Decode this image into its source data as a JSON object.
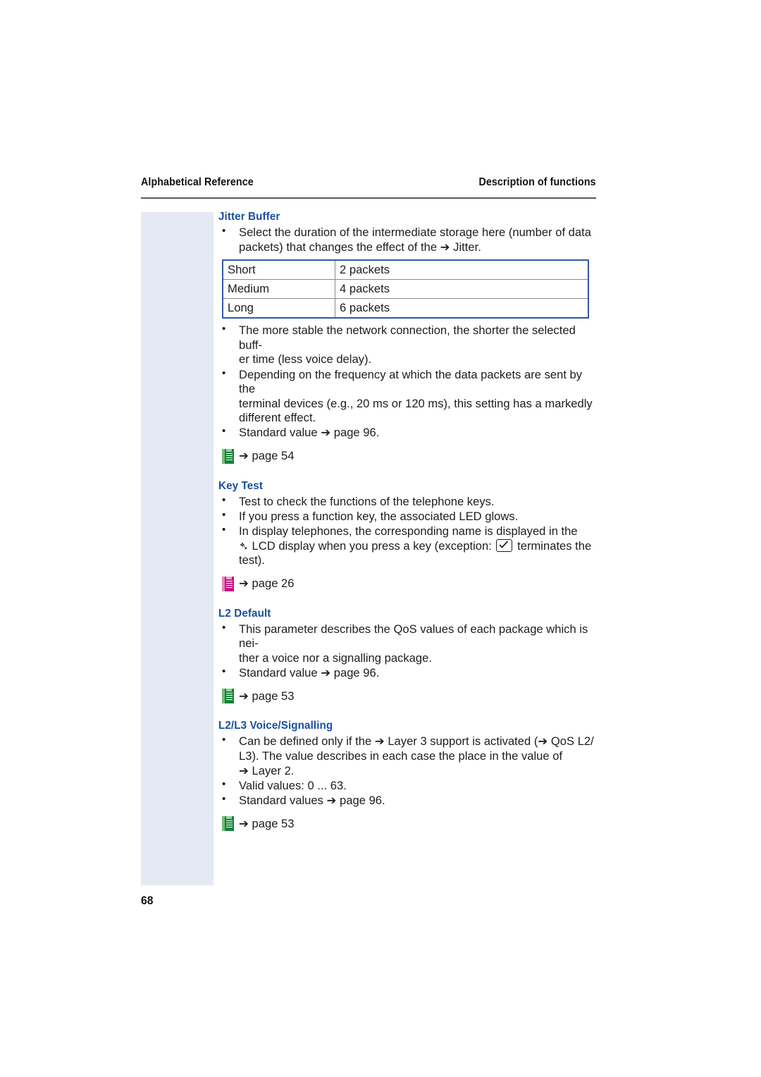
{
  "header": {
    "left": "Alphabetical Reference",
    "right": "Description of functions"
  },
  "folio": "68",
  "colors": {
    "heading": "#1a4fa0",
    "band": "#e4e9f4",
    "table_border": "#3457a8",
    "icon_green": "#17803a",
    "icon_magenta": "#c2167d"
  },
  "sections": [
    {
      "title": "Jitter Buffer",
      "bullets_before_table": [
        {
          "lines": [
            "Select the duration of the intermediate storage here (number of data",
            "packets) that changes the effect of the ➔ Jitter."
          ]
        }
      ],
      "table": {
        "rows": [
          {
            "key": "Short",
            "value": "2 packets"
          },
          {
            "key": "Medium",
            "value": "4 packets"
          },
          {
            "key": "Long",
            "value": "6 packets"
          }
        ]
      },
      "bullets_after_table": [
        {
          "lines": [
            "The more stable the network connection, the shorter the selected buff-",
            "er time (less voice delay)."
          ]
        },
        {
          "lines": [
            "Depending on the frequency at which the data packets are sent by the",
            "terminal devices (e.g., 20 ms or 120 ms), this setting has a markedly",
            "different effect."
          ]
        },
        {
          "lines": [
            "Standard value ➔ page 96."
          ]
        }
      ],
      "xref": {
        "icon": "booklet-icon-green",
        "text": "➔ page 54"
      }
    },
    {
      "title": "Key Test",
      "bullets": [
        {
          "lines": [
            "Test to check the functions of the telephone keys."
          ]
        },
        {
          "lines": [
            "If you press a function key, the associated LED glows."
          ]
        },
        {
          "html_lines": [
            "In display telephones, the corresponding name is displayed in the",
            "➔ LCD display when you press a key (exception: [checkbox-key-icon] terminates the",
            "test)."
          ]
        }
      ],
      "xref": {
        "icon": "booklet-icon-magenta",
        "text": "➔ page 26"
      }
    },
    {
      "title": "L2 Default",
      "bullets": [
        {
          "lines": [
            "This parameter describes the QoS values of each package which is nei-",
            "ther a voice nor a signalling package."
          ]
        },
        {
          "lines": [
            "Standard value ➔ page 96."
          ]
        }
      ],
      "xref": {
        "icon": "booklet-icon-green",
        "text": "➔ page 53"
      }
    },
    {
      "title": "L2/L3 Voice/Signalling",
      "bullets": [
        {
          "lines": [
            "Can be defined only if the ➔ Layer 3 support is activated (➔ QoS L2/",
            "L3). The value describes in each case the place in the value of",
            "➔ Layer 2."
          ]
        },
        {
          "lines": [
            "Valid values: 0 ... 63."
          ]
        },
        {
          "lines": [
            "Standard values ➔ page 96."
          ]
        }
      ],
      "xref": {
        "icon": "booklet-icon-green",
        "text": "➔ page 53"
      }
    }
  ]
}
